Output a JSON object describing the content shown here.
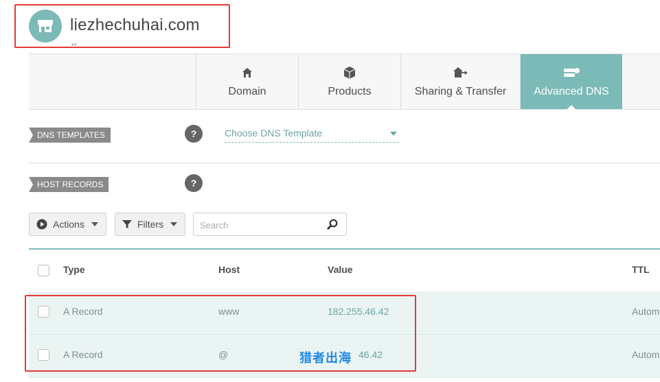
{
  "header": {
    "domain_title": "liezhechuhai.com",
    "small_mark": "■+"
  },
  "tabs": [
    {
      "label": "Domain",
      "icon": "home-icon",
      "active": false
    },
    {
      "label": "Products",
      "icon": "box-icon",
      "active": false
    },
    {
      "label": "Sharing & Transfer",
      "icon": "house-transfer-icon",
      "active": false
    },
    {
      "label": "Advanced DNS",
      "icon": "server-dns-icon",
      "active": true
    }
  ],
  "dns_templates": {
    "label": "DNS TEMPLATES",
    "help": "?",
    "select_value": "Choose DNS Template"
  },
  "host_records": {
    "label": "HOST RECORDS",
    "help": "?"
  },
  "toolbar": {
    "actions_label": "Actions",
    "filters_label": "Filters",
    "search_placeholder": "Search"
  },
  "table": {
    "columns": [
      "Type",
      "Host",
      "Value",
      "TTL"
    ],
    "rows": [
      {
        "type": "A Record",
        "host": "www",
        "value": "182.255.46.42",
        "ttl": "Autom"
      },
      {
        "type": "A Record",
        "host": "@",
        "value": "46.42",
        "ttl": "Autom"
      }
    ]
  },
  "watermark": "猎者出海",
  "colors": {
    "accent": "#7bbab7",
    "annotation_red": "#e53935",
    "row_bg": "#eaf4f3",
    "label_grey": "#8a8a8a"
  }
}
